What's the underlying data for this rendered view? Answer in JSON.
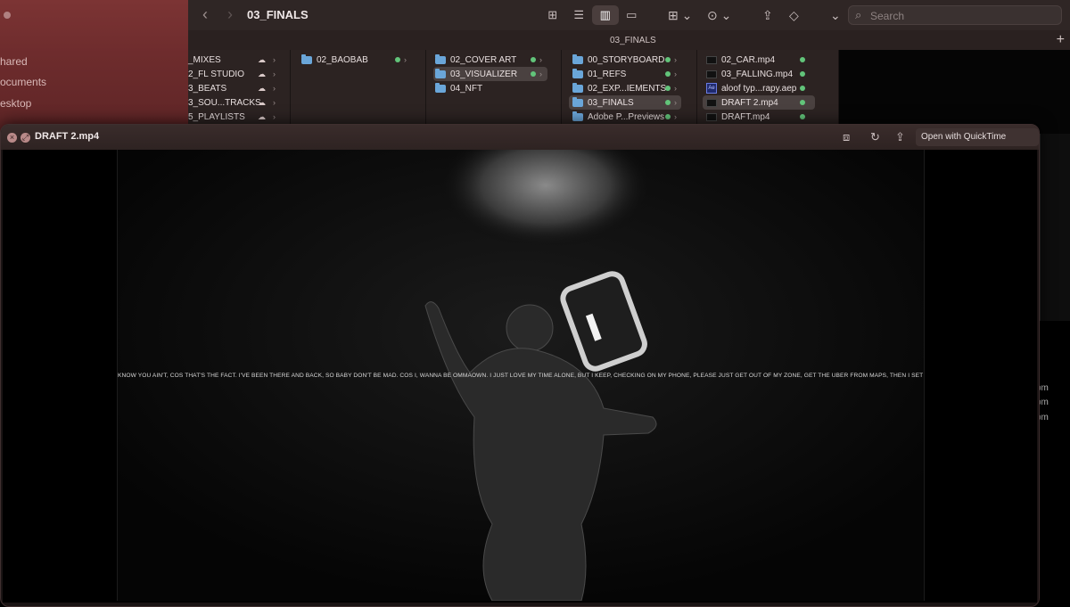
{
  "finder": {
    "window_title": "03_FINALS",
    "path_title": "03_FINALS",
    "search_placeholder": "Search",
    "sidebar": [
      "hared",
      "ocuments",
      "esktop"
    ],
    "columns": [
      {
        "items": [
          {
            "label": "_MIXES",
            "kind": "folder",
            "status": "cloud"
          },
          {
            "label": "2_FL STUDIO",
            "kind": "folder",
            "status": "cloud"
          },
          {
            "label": "3_BEATS",
            "kind": "folder",
            "status": "cloud"
          },
          {
            "label": "3_SOU...TRACKS",
            "kind": "folder",
            "status": "cloud"
          },
          {
            "label": "5_PLAYLISTS",
            "kind": "folder",
            "status": "cloud"
          }
        ]
      },
      {
        "items": [
          {
            "label": "02_BAOBAB",
            "kind": "folder",
            "status": "synced"
          }
        ]
      },
      {
        "items": [
          {
            "label": "02_COVER ART",
            "kind": "folder",
            "status": "synced"
          },
          {
            "label": "03_VISUALIZER",
            "kind": "folder",
            "status": "synced",
            "selected": true
          },
          {
            "label": "04_NFT",
            "kind": "folder",
            "status": "synced"
          }
        ]
      },
      {
        "items": [
          {
            "label": "00_STORYBOARD",
            "kind": "folder",
            "status": "synced"
          },
          {
            "label": "01_REFS",
            "kind": "folder",
            "status": "synced"
          },
          {
            "label": "02_EXP...IEMENTS",
            "kind": "folder",
            "status": "synced"
          },
          {
            "label": "03_FINALS",
            "kind": "folder",
            "status": "synced",
            "selected": true
          },
          {
            "label": "Adobe P...Previews",
            "kind": "folder",
            "status": "synced"
          }
        ]
      },
      {
        "items": [
          {
            "label": "02_CAR.mp4",
            "kind": "video",
            "status": "synced"
          },
          {
            "label": "03_FALLING.mp4",
            "kind": "video",
            "status": "synced"
          },
          {
            "label": "aloof typ...rapy.aep",
            "kind": "aep",
            "status": "synced"
          },
          {
            "label": "DRAFT 2.mp4",
            "kind": "video",
            "status": "synced",
            "selected": true
          },
          {
            "label": "DRAFT.mp4",
            "kind": "video",
            "status": "synced"
          }
        ]
      }
    ],
    "times": [
      "pm",
      "pm",
      "pm"
    ]
  },
  "quicklook": {
    "title": "DRAFT 2.mp4",
    "open_button": "Open with QuickTime Player",
    "lyrics": "KNOW YOU AIN'T, COS THAT'S THE FACT. I'VE BEEN THERE AND BACK, SO BABY DON'T BE MAD. COS I, WANNA BE OMMAOWN. I JUST LOVE MY TIME ALONE, BUT I KEEP, CHECKING ON MY PHONE, PLEASE JUST GET OUT OF MY ZONE, GET THE UBER FROM MAPS, THEN I SET THAT SHIT TO HOME ,SEE NOW I'M FE"
  },
  "colors": {
    "sync": "#62c47a",
    "folder": "#6aa6d9",
    "sidebar": "#6e2c2d"
  }
}
